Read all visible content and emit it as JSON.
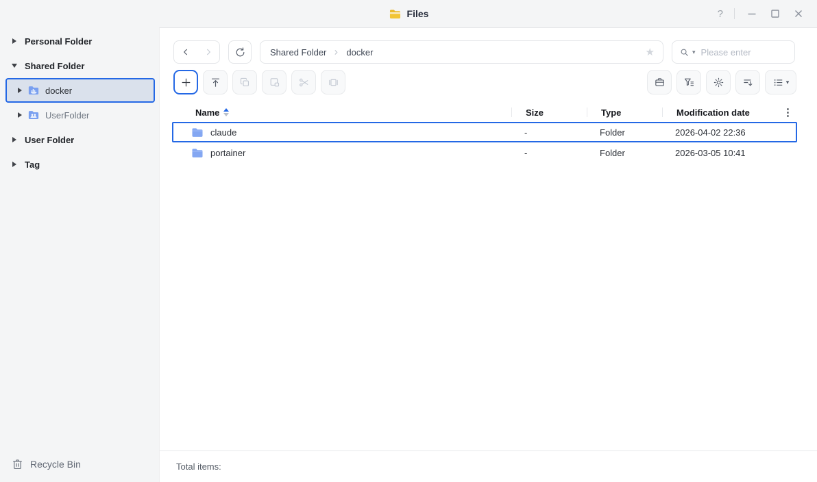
{
  "titlebar": {
    "title": "Files",
    "help_glyph": "?"
  },
  "sidebar": {
    "items": [
      {
        "label": "Personal Folder"
      },
      {
        "label": "Shared Folder"
      },
      {
        "label": "docker"
      },
      {
        "label": "UserFolder"
      },
      {
        "label": "User Folder"
      },
      {
        "label": "Tag"
      }
    ],
    "recycle_bin_label": "Recycle Bin"
  },
  "toolbar": {
    "breadcrumb": {
      "root": "Shared Folder",
      "current": "docker"
    },
    "search_placeholder": "Please enter"
  },
  "icons": {
    "star_glyph": "★",
    "more_glyph": "⋮",
    "caret_glyph": "▾"
  },
  "table": {
    "columns": {
      "name": "Name",
      "size": "Size",
      "type": "Type",
      "modified": "Modification date"
    },
    "sort": {
      "column": "Name",
      "direction": "asc"
    },
    "rows": [
      {
        "name": "claude",
        "size": "-",
        "type": "Folder",
        "modified": "2026-04-02 22:36",
        "selected": true
      },
      {
        "name": "portainer",
        "size": "-",
        "type": "Folder",
        "modified": "2026-03-05 10:41",
        "selected": false
      }
    ]
  },
  "statusbar": {
    "total_label": "Total items:"
  },
  "colors": {
    "accent": "#2468e5",
    "sidebar_selected_bg": "#dae1ec",
    "folder_icon_blue": "#84a7f2",
    "files_icon_yellow": "#f2c535"
  }
}
